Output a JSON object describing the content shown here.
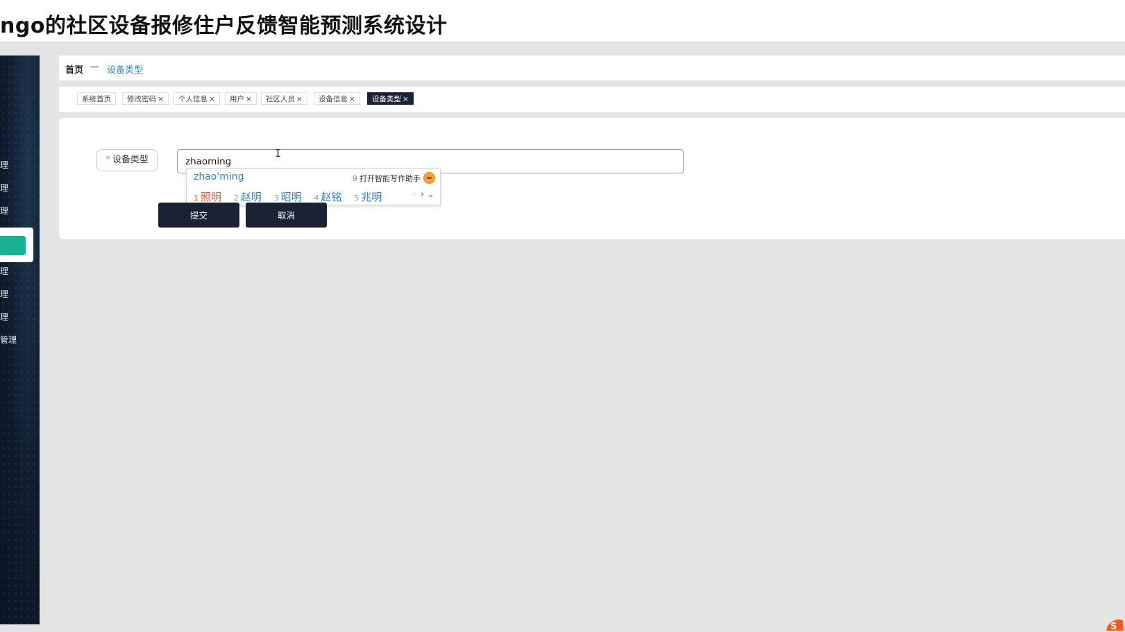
{
  "window": {
    "title": "ngo的社区设备报修住户反馈智能预测系统设计"
  },
  "sidebar": {
    "items": [
      {
        "label": "理"
      },
      {
        "label": "理"
      },
      {
        "label": "理"
      },
      {
        "label": ""
      },
      {
        "label": "理"
      },
      {
        "label": "理"
      },
      {
        "label": "理"
      },
      {
        "label": "管理"
      }
    ]
  },
  "breadcrumb": {
    "home": "首页",
    "separator": "—",
    "current": "设备类型"
  },
  "tabs": [
    {
      "label": "系统首页",
      "closable": false
    },
    {
      "label": "修改密码",
      "closable": true
    },
    {
      "label": "个人信息",
      "closable": true
    },
    {
      "label": "用户",
      "closable": true
    },
    {
      "label": "社区人员",
      "closable": true
    },
    {
      "label": "设备信息",
      "closable": true
    },
    {
      "label": "设备类型",
      "closable": true,
      "active": true
    }
  ],
  "tab_close_glyph": "×",
  "form": {
    "required_mark": "*",
    "label": "设备类型",
    "value": "zhaoming",
    "submit_label": "提交",
    "cancel_label": "取消"
  },
  "ime": {
    "pinyin": "zhao'ming",
    "assist_num": "9",
    "assist_text": "打开智能写作助手",
    "candidates": [
      {
        "n": "1",
        "text": "照明"
      },
      {
        "n": "2",
        "text": "赵明"
      },
      {
        "n": "3",
        "text": "昭明"
      },
      {
        "n": "4",
        "text": "赵铭"
      },
      {
        "n": "5",
        "text": "兆明"
      }
    ],
    "prev_glyph": "‹",
    "next_glyph": "›",
    "expand_glyph": "⌄"
  },
  "colors": {
    "accent_green": "#19b394",
    "dark_navy": "#1a2233",
    "link_blue": "#2d8cd8",
    "ime_highlight": "#e4572e"
  }
}
